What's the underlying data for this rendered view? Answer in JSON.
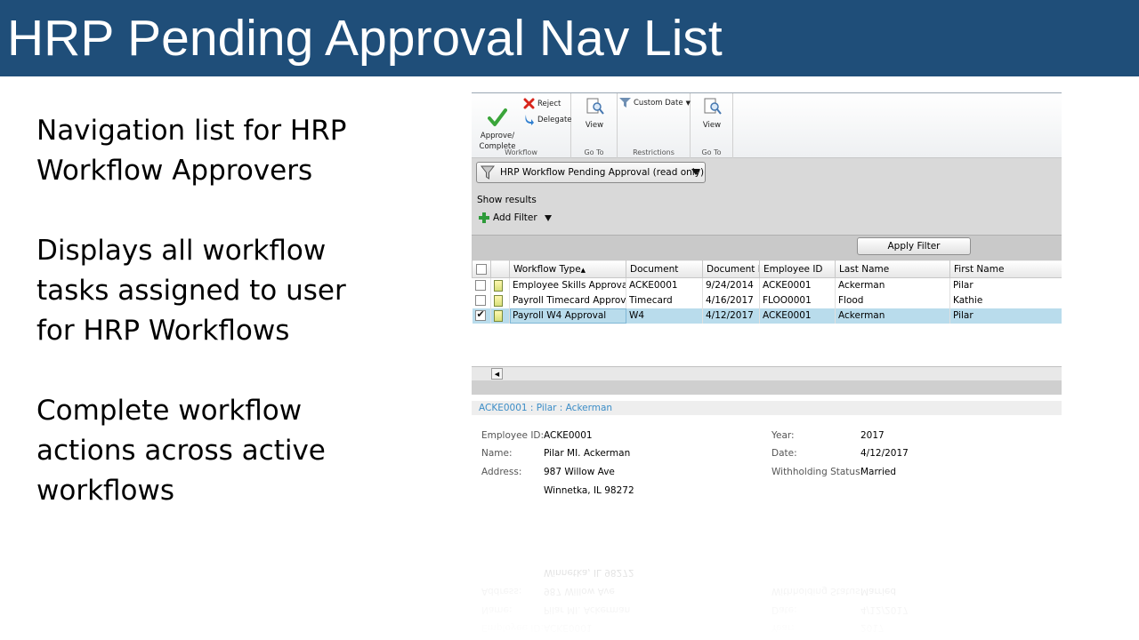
{
  "slide": {
    "title": "HRP Pending Approval Nav List",
    "bullets": [
      "Navigation list for HRP\nWorkflow Approvers",
      "Displays all workflow\ntasks assigned to user\nfor HRP Workflows",
      "Complete workflow\nactions across active\nworkflows"
    ]
  },
  "ribbon": {
    "approve_label": "Approve/\nComplete",
    "reject_label": "Reject",
    "delegate_label": "Delegate",
    "workflow_group": "Workflow",
    "view1_label": "View",
    "goto1_group": "Go To",
    "custom_date_label": "Custom Date",
    "restrictions_group": "Restrictions",
    "view2_label": "View",
    "goto2_group": "Go To"
  },
  "filter": {
    "view_name": "HRP Workflow Pending Approval (read only)",
    "show_results": "Show results",
    "add_filter": "Add Filter",
    "apply_filter": "Apply Filter"
  },
  "grid": {
    "columns": [
      "Workflow Type",
      "Document",
      "Document D",
      "Employee ID",
      "Last Name",
      "First Name"
    ],
    "rows": [
      {
        "checked": false,
        "selected": false,
        "workflow_type": "Employee Skills Approval",
        "document": "ACKE0001",
        "document_date": "9/24/2014",
        "employee_id": "ACKE0001",
        "last_name": "Ackerman",
        "first_name": "Pilar"
      },
      {
        "checked": false,
        "selected": false,
        "workflow_type": "Payroll Timecard Approval",
        "document": "Timecard",
        "document_date": "4/16/2017",
        "employee_id": "FLOO0001",
        "last_name": "Flood",
        "first_name": "Kathie"
      },
      {
        "checked": true,
        "selected": true,
        "workflow_type": "Payroll W4 Approval",
        "document": "W4",
        "document_date": "4/12/2017",
        "employee_id": "ACKE0001",
        "last_name": "Ackerman",
        "first_name": "Pilar"
      }
    ]
  },
  "detail": {
    "header": "ACKE0001 : Pilar : Ackerman",
    "employee_id_label": "Employee ID:",
    "employee_id": "ACKE0001",
    "name_label": "Name:",
    "name": "Pilar MI. Ackerman",
    "address_label": "Address:",
    "address_line1": "987 Willow Ave",
    "address_line2": "Winnetka, IL 98272",
    "year_label": "Year:",
    "year": "2017",
    "date_label": "Date:",
    "date": "4/12/2017",
    "withholding_label": "Withholding Status:",
    "withholding": "Married"
  },
  "colors": {
    "title_bar": "#1f4e79",
    "selected_row": "#b9dcec",
    "detail_header_text": "#3c8dc7"
  }
}
